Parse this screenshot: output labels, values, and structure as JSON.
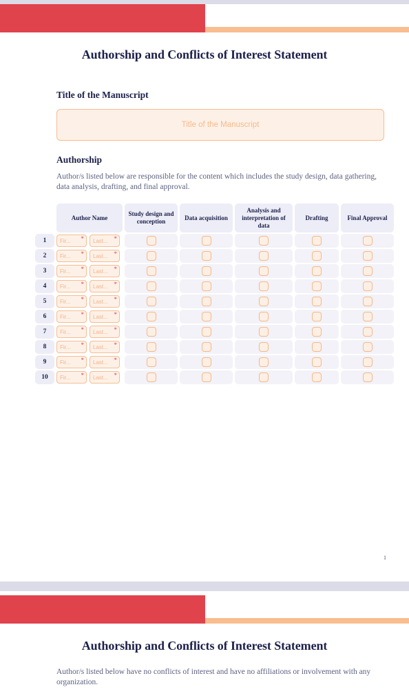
{
  "document": {
    "title": "Authorship and Conflicts of Interest Statement",
    "page_number": "1"
  },
  "colors": {
    "accent_red": "#e0434c",
    "accent_orange": "#f9bd8f",
    "heading_navy": "#1c2049",
    "field_bg": "#fdf1e7",
    "field_border": "#f6bc91",
    "header_cell_bg": "#ededf7",
    "page_separator": "#dcdce8"
  },
  "page1": {
    "title": "Authorship and Conflicts of Interest Statement",
    "manuscript_section": {
      "label": "Title of the Manuscript",
      "input_value": "",
      "input_placeholder": "Title of the Manuscript"
    },
    "authorship_section": {
      "label": "Authorship",
      "description": "Author/s listed below are responsible for the content which includes the study design, data gathering, data analysis, drafting, and final approval."
    },
    "table": {
      "headers": [
        "",
        "Author Name",
        "Study design and conception",
        "Data acquisition",
        "Analysis and interpretation of data",
        "Drafting",
        "Final Approval"
      ],
      "first_name_placeholder": "Fir...",
      "last_name_placeholder": "Last...",
      "required_marker": "*",
      "rows": [
        {
          "number": "1",
          "first_name": "",
          "last_name": "",
          "study_design": false,
          "data_acquisition": false,
          "analysis": false,
          "drafting": false,
          "final_approval": false
        },
        {
          "number": "2",
          "first_name": "",
          "last_name": "",
          "study_design": false,
          "data_acquisition": false,
          "analysis": false,
          "drafting": false,
          "final_approval": false
        },
        {
          "number": "3",
          "first_name": "",
          "last_name": "",
          "study_design": false,
          "data_acquisition": false,
          "analysis": false,
          "drafting": false,
          "final_approval": false
        },
        {
          "number": "4",
          "first_name": "",
          "last_name": "",
          "study_design": false,
          "data_acquisition": false,
          "analysis": false,
          "drafting": false,
          "final_approval": false
        },
        {
          "number": "5",
          "first_name": "",
          "last_name": "",
          "study_design": false,
          "data_acquisition": false,
          "analysis": false,
          "drafting": false,
          "final_approval": false
        },
        {
          "number": "6",
          "first_name": "",
          "last_name": "",
          "study_design": false,
          "data_acquisition": false,
          "analysis": false,
          "drafting": false,
          "final_approval": false
        },
        {
          "number": "7",
          "first_name": "",
          "last_name": "",
          "study_design": false,
          "data_acquisition": false,
          "analysis": false,
          "drafting": false,
          "final_approval": false
        },
        {
          "number": "8",
          "first_name": "",
          "last_name": "",
          "study_design": false,
          "data_acquisition": false,
          "analysis": false,
          "drafting": false,
          "final_approval": false
        },
        {
          "number": "9",
          "first_name": "",
          "last_name": "",
          "study_design": false,
          "data_acquisition": false,
          "analysis": false,
          "drafting": false,
          "final_approval": false
        },
        {
          "number": "10",
          "first_name": "",
          "last_name": "",
          "study_design": false,
          "data_acquisition": false,
          "analysis": false,
          "drafting": false,
          "final_approval": false
        }
      ]
    }
  },
  "page2": {
    "title": "Authorship and Conflicts of Interest Statement",
    "description": "Author/s listed below have no conflicts of interest and have no affiliations or involvement with any organization."
  }
}
